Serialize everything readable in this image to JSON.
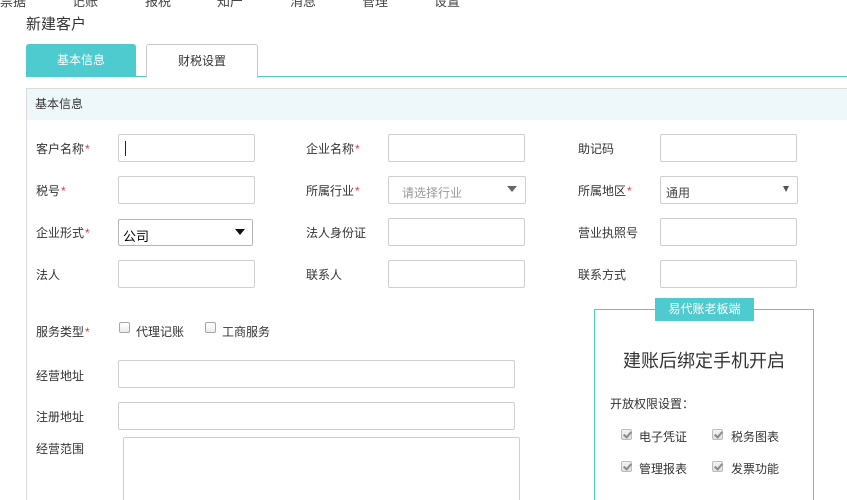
{
  "top_nav": [
    "票据",
    "记账",
    "报税",
    "知产",
    "消息",
    "管理",
    "设置"
  ],
  "dialog": {
    "title": "新建客户"
  },
  "tabs": {
    "basic": "基本信息",
    "tax": "财税设置"
  },
  "section": {
    "title": "基本信息"
  },
  "fields": {
    "customer_name": {
      "label": "客户名称",
      "req": "*",
      "value": ""
    },
    "company_name": {
      "label": "企业名称",
      "req": "*",
      "value": ""
    },
    "mnemonic": {
      "label": "助记码",
      "value": ""
    },
    "tax_no": {
      "label": "税号",
      "req": "*",
      "value": ""
    },
    "industry": {
      "label": "所属行业",
      "req": "*",
      "placeholder": "请选择行业"
    },
    "region": {
      "label": "所属地区",
      "req": "*",
      "value": "通用"
    },
    "company_form": {
      "label": "企业形式",
      "req": "*",
      "value": "公司"
    },
    "legal_id": {
      "label": "法人身份证",
      "value": ""
    },
    "license_no": {
      "label": "营业执照号",
      "value": ""
    },
    "legal_person": {
      "label": "法人",
      "value": ""
    },
    "contact": {
      "label": "联系人",
      "value": ""
    },
    "contact_info": {
      "label": "联系方式",
      "value": ""
    },
    "service_type": {
      "label": "服务类型",
      "req": "*",
      "options": [
        "代理记账",
        "工商服务"
      ]
    },
    "business_address": {
      "label": "经营地址",
      "value": ""
    },
    "registered_address": {
      "label": "注册地址",
      "value": ""
    },
    "business_scope": {
      "label": "经营范围",
      "value": ""
    }
  },
  "bind_panel": {
    "badge": "易代账老板端",
    "title": "建账后绑定手机开启",
    "perm_label": "开放权限设置：",
    "perms": [
      "电子凭证",
      "税务图表",
      "管理报表",
      "发票功能"
    ]
  },
  "colors": {
    "accent": "#4ecbcf",
    "required": "#e4393c",
    "section_bg": "#eef8fb"
  }
}
